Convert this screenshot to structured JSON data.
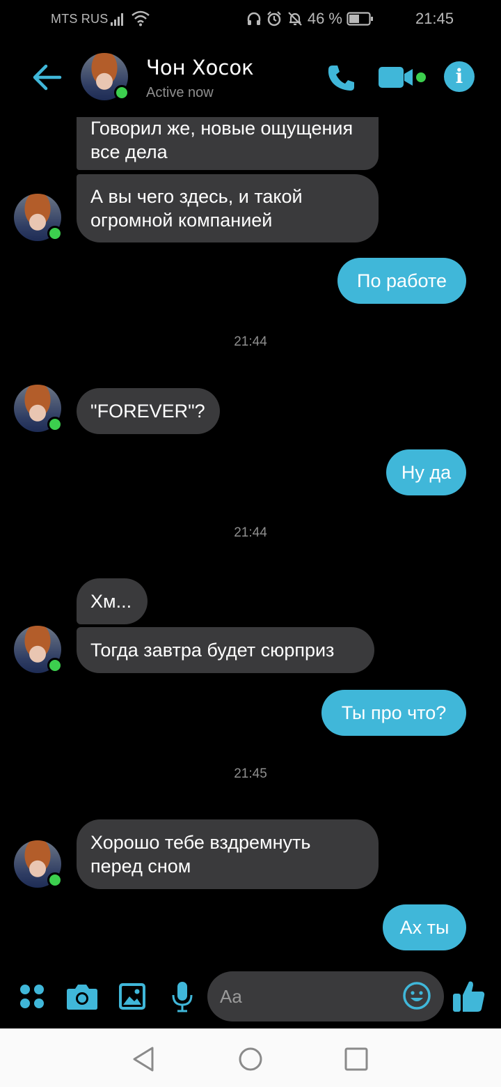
{
  "status_bar": {
    "carrier": "MTS RUS",
    "battery": "46 %",
    "time": "21:45"
  },
  "header": {
    "contact_name": "Чон Хосок",
    "contact_status": "Active now"
  },
  "messages": [
    {
      "text": "Говорил же, новые ощущения все дела"
    },
    {
      "text": "А вы чего здесь, и такой огромной компанией"
    },
    {
      "text": "По работе"
    },
    {
      "text": "21:44"
    },
    {
      "text": "\"FOREVER\"?"
    },
    {
      "text": "Ну да"
    },
    {
      "text": "21:44"
    },
    {
      "text": "Хм..."
    },
    {
      "text": "Тогда завтра будет сюрприз"
    },
    {
      "text": "Ты про что?"
    },
    {
      "text": "21:45"
    },
    {
      "text": "Хорошо тебе вздремнуть перед сном"
    },
    {
      "text": "Ах ты"
    }
  ],
  "composer": {
    "placeholder": "Aa"
  },
  "colors": {
    "accent": "#40b7d9",
    "incoming_bubble": "#3a3a3c",
    "online_dot": "#3ccf4e",
    "background": "#000000"
  },
  "icons": [
    "back-arrow-icon",
    "phone-icon",
    "video-camera-icon",
    "info-icon",
    "apps-grid-icon",
    "camera-icon",
    "image-icon",
    "microphone-icon",
    "emoji-icon",
    "thumbs-up-icon"
  ]
}
